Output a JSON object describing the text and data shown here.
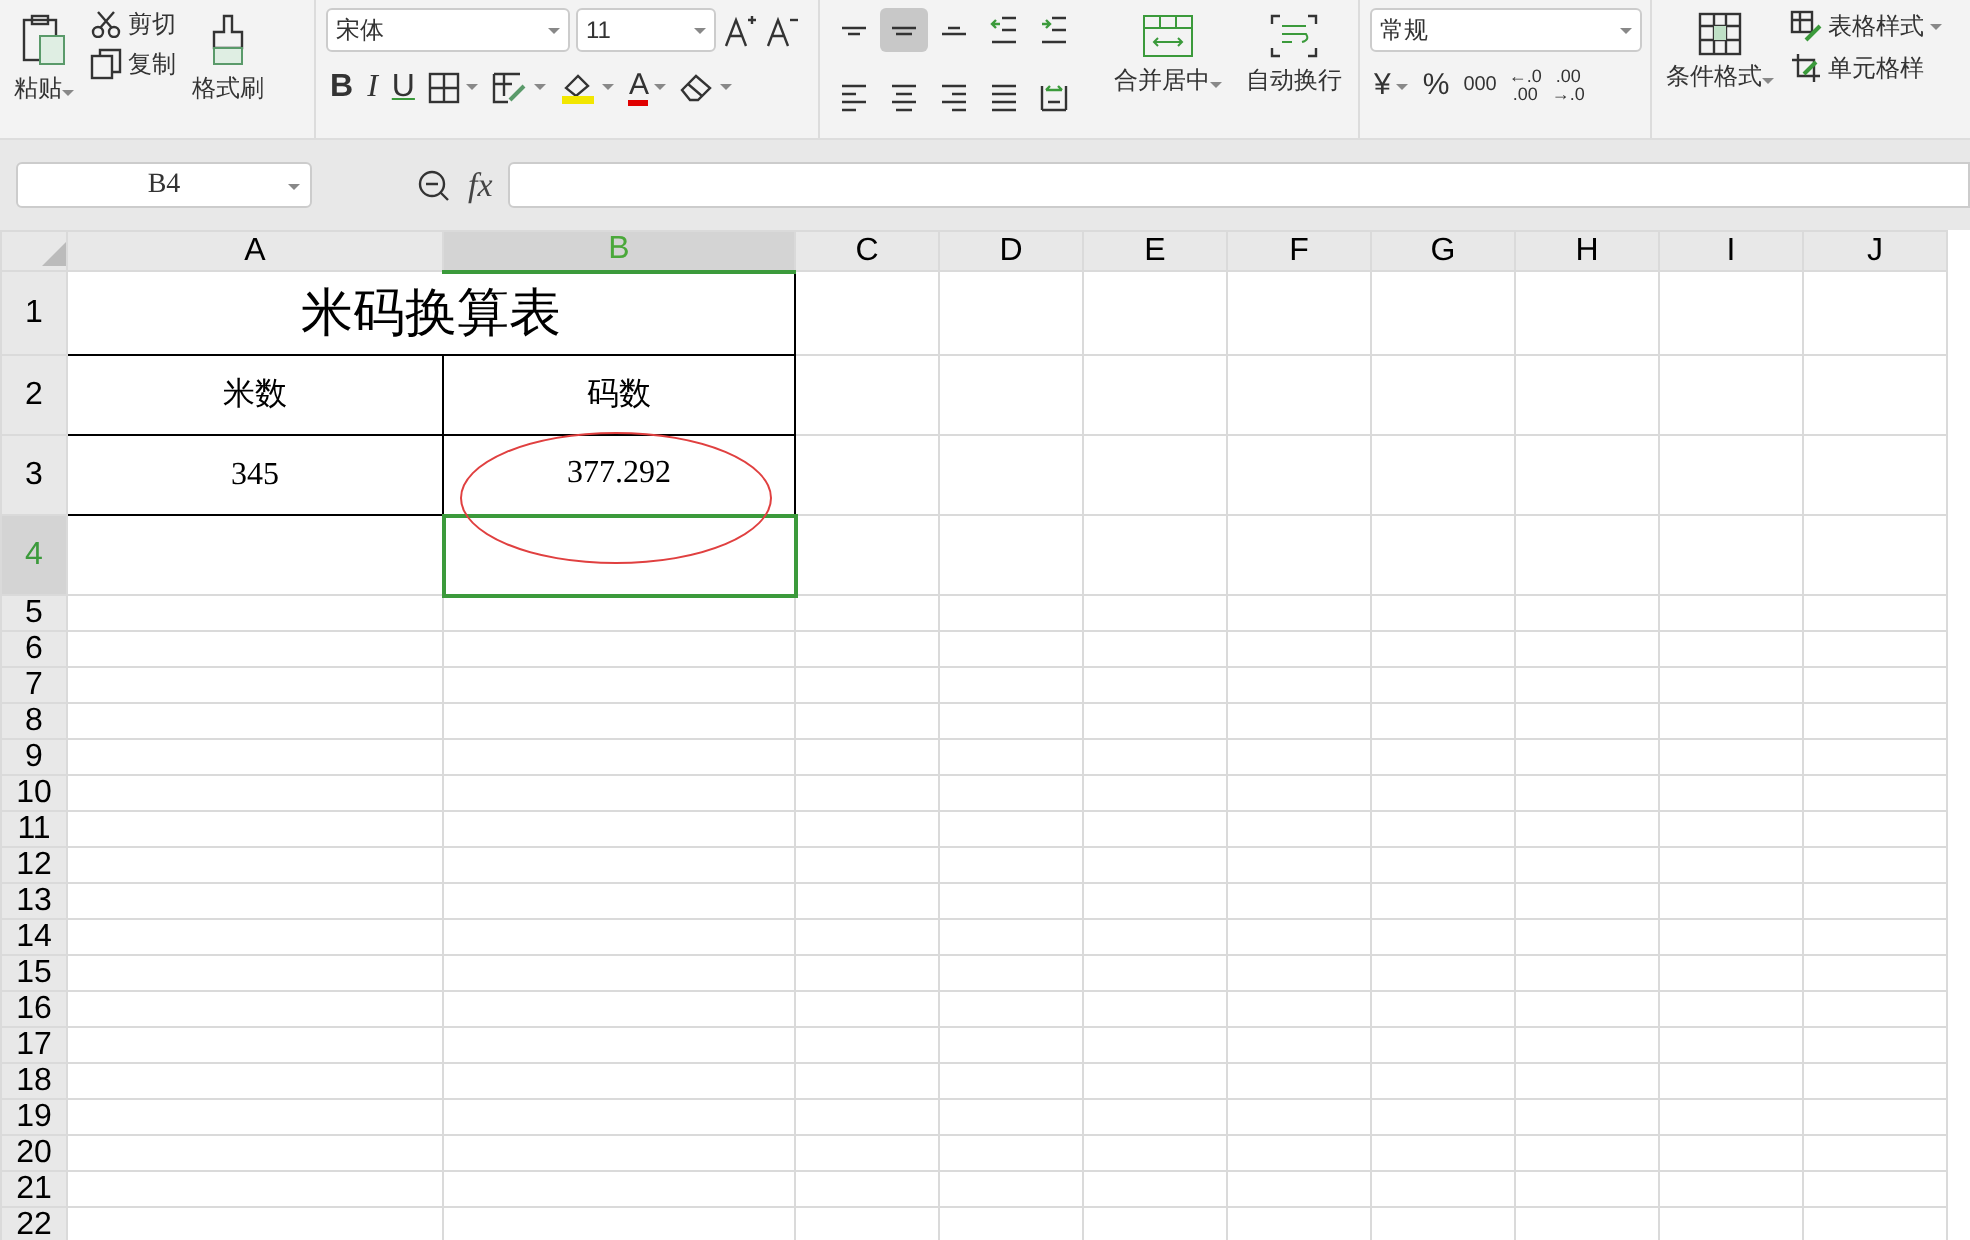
{
  "ribbon": {
    "clipboard": {
      "paste": "粘贴",
      "cut": "剪切",
      "copy": "复制",
      "format_painter": "格式刷"
    },
    "font": {
      "name": "宋体",
      "size": "11",
      "bold": "B",
      "italic": "I",
      "underline": "U",
      "font_color": "A"
    },
    "alignment": {
      "buttons": [
        {
          "kind": "top",
          "selected": false
        },
        {
          "kind": "middle",
          "selected": true
        },
        {
          "kind": "bottom",
          "selected": false
        },
        {
          "kind": "outdent",
          "selected": false
        },
        {
          "kind": "indent",
          "selected": false
        },
        {
          "kind": "left",
          "selected": false
        },
        {
          "kind": "center",
          "selected": false
        },
        {
          "kind": "right",
          "selected": false
        },
        {
          "kind": "justify",
          "selected": false
        },
        {
          "kind": "distributed",
          "selected": false
        }
      ],
      "merge": "合并居中",
      "wrap": "自动换行"
    },
    "number": {
      "format": "常规",
      "currency": "¥",
      "percent": "%",
      "thousands": "000",
      "decimals": [
        {
          "top": "←.0",
          "bottom": ".00"
        },
        {
          "top": ".00",
          "bottom": "→.0"
        }
      ]
    },
    "styles": {
      "conditional": "条件格式",
      "table_style": "表格样式",
      "cell_style": "单元格样"
    }
  },
  "formula_bar": {
    "name_box": "B4",
    "fx": "fx"
  },
  "sheet": {
    "columns": [
      {
        "label": "A",
        "selected": false
      },
      {
        "label": "B",
        "selected": true
      },
      {
        "label": "C",
        "selected": false
      },
      {
        "label": "D",
        "selected": false
      },
      {
        "label": "E",
        "selected": false
      },
      {
        "label": "F",
        "selected": false
      },
      {
        "label": "G",
        "selected": false
      },
      {
        "label": "H",
        "selected": false
      },
      {
        "label": "I",
        "selected": false
      },
      {
        "label": "J",
        "selected": false
      }
    ],
    "rows": [
      {
        "label": "1",
        "selected": false,
        "cells": [
          {
            "text": "米码换算表",
            "merged": true,
            "outlined": true,
            "circled": false,
            "selected": false
          }
        ]
      },
      {
        "label": "2",
        "selected": false,
        "cells": [
          {
            "text": "米数",
            "merged": false,
            "outlined": true,
            "circled": false,
            "selected": false
          },
          {
            "text": "码数",
            "merged": false,
            "outlined": true,
            "circled": false,
            "selected": false
          }
        ]
      },
      {
        "label": "3",
        "selected": false,
        "cells": [
          {
            "text": "345",
            "merged": false,
            "outlined": true,
            "circled": false,
            "selected": false
          },
          {
            "text": "377.292",
            "merged": false,
            "outlined": true,
            "circled": true,
            "selected": false
          }
        ]
      },
      {
        "label": "4",
        "selected": true,
        "cells": [
          {
            "merged": false,
            "outlined": false,
            "circled": false,
            "selected": false
          },
          {
            "merged": false,
            "outlined": false,
            "circled": false,
            "selected": true
          }
        ]
      },
      {
        "label": "5",
        "selected": false
      },
      {
        "label": "6",
        "selected": false
      },
      {
        "label": "7",
        "selected": false
      },
      {
        "label": "8",
        "selected": false
      },
      {
        "label": "9",
        "selected": false
      },
      {
        "label": "10",
        "selected": false
      },
      {
        "label": "11",
        "selected": false
      },
      {
        "label": "12",
        "selected": false
      },
      {
        "label": "13",
        "selected": false
      },
      {
        "label": "14",
        "selected": false
      },
      {
        "label": "15",
        "selected": false
      },
      {
        "label": "16",
        "selected": false
      },
      {
        "label": "17",
        "selected": false
      },
      {
        "label": "18",
        "selected": false
      },
      {
        "label": "19",
        "selected": false
      },
      {
        "label": "20",
        "selected": false
      },
      {
        "label": "21",
        "selected": false
      },
      {
        "label": "22",
        "selected": false
      }
    ]
  }
}
